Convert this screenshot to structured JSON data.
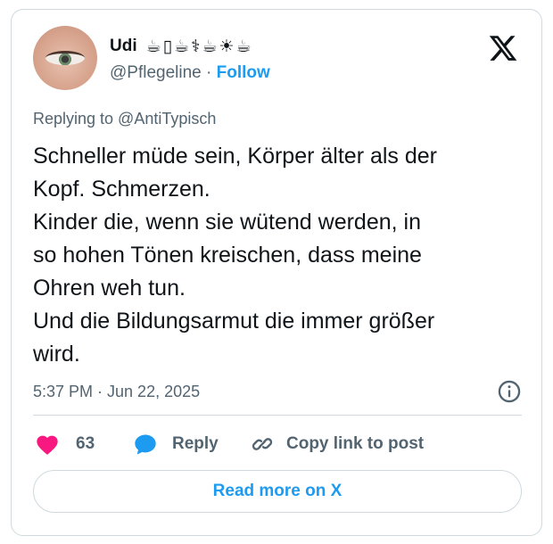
{
  "author": {
    "display_name": "Udi",
    "name_emojis": [
      "☕",
      "▯",
      "☕",
      "⚕",
      "☕",
      "☀",
      "☕"
    ],
    "handle": "@Pflegeline",
    "separator": "·",
    "follow_label": "Follow",
    "avatar": "avatar-eye-closeup"
  },
  "reply_context": "Replying to @AntiTypisch",
  "tweet": {
    "text": "Schneller müde sein, Körper älter als der\nKopf. Schmerzen.\nKinder die, wenn sie wütend werden, in\nso hohen Tönen kreischen, dass meine\nOhren weh tun.\nUnd die Bildungsarmut die immer größer\nwird."
  },
  "meta": {
    "timestamp": "5:37 PM · Jun 22, 2025",
    "info_icon": "info-icon"
  },
  "actions": {
    "like_count": "63",
    "reply_label": "Reply",
    "copy_label": "Copy link to post"
  },
  "read_more_label": "Read more on X",
  "colors": {
    "accent": "#1d9bf0",
    "heart": "#f91880",
    "muted_text": "#536471",
    "border": "#cfd9de",
    "text": "#0f1419"
  },
  "icons": [
    "x-logo-icon",
    "info-icon",
    "heart-icon",
    "reply-bubble-icon",
    "link-icon"
  ]
}
